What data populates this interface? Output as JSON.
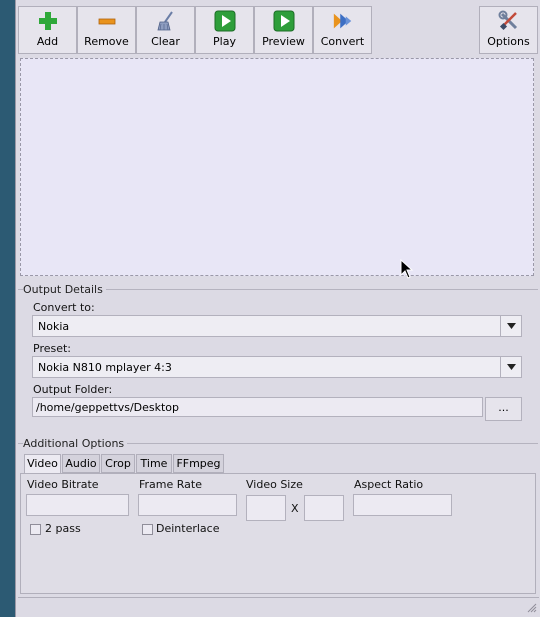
{
  "toolbar": {
    "add_label": "Add",
    "remove_label": "Remove",
    "clear_label": "Clear",
    "play_label": "Play",
    "preview_label": "Preview",
    "convert_label": "Convert",
    "options_label": "Options"
  },
  "output_details": {
    "group_title": "Output Details",
    "convert_to_label": "Convert to:",
    "convert_to_value": "Nokia",
    "preset_label": "Preset:",
    "preset_value": "Nokia N810 mplayer 4:3",
    "output_folder_label": "Output Folder:",
    "output_folder_value": "/home/geppettvs/Desktop",
    "browse_label": "..."
  },
  "additional_options": {
    "group_title": "Additional Options",
    "tabs": [
      "Video",
      "Audio",
      "Crop",
      "Time",
      "FFmpeg"
    ],
    "active_tab": "Video",
    "video": {
      "bitrate_label": "Video Bitrate",
      "framerate_label": "Frame Rate",
      "size_label": "Video Size",
      "size_separator": "X",
      "aspect_label": "Aspect Ratio",
      "two_pass_label": "2 pass",
      "deinterlace_label": "Deinterlace"
    }
  },
  "colors": {
    "add_green": "#2fa83a",
    "remove_orange": "#e9931d",
    "play_green": "#2e9e3a",
    "convert_blue": "#3d6fc4"
  },
  "icons": {
    "add": "plus-icon",
    "remove": "minus-icon",
    "clear": "broom-icon",
    "play": "play-icon",
    "preview": "preview-play-icon",
    "convert": "double-arrow-icon",
    "options": "wrench-screwdriver-icon"
  }
}
